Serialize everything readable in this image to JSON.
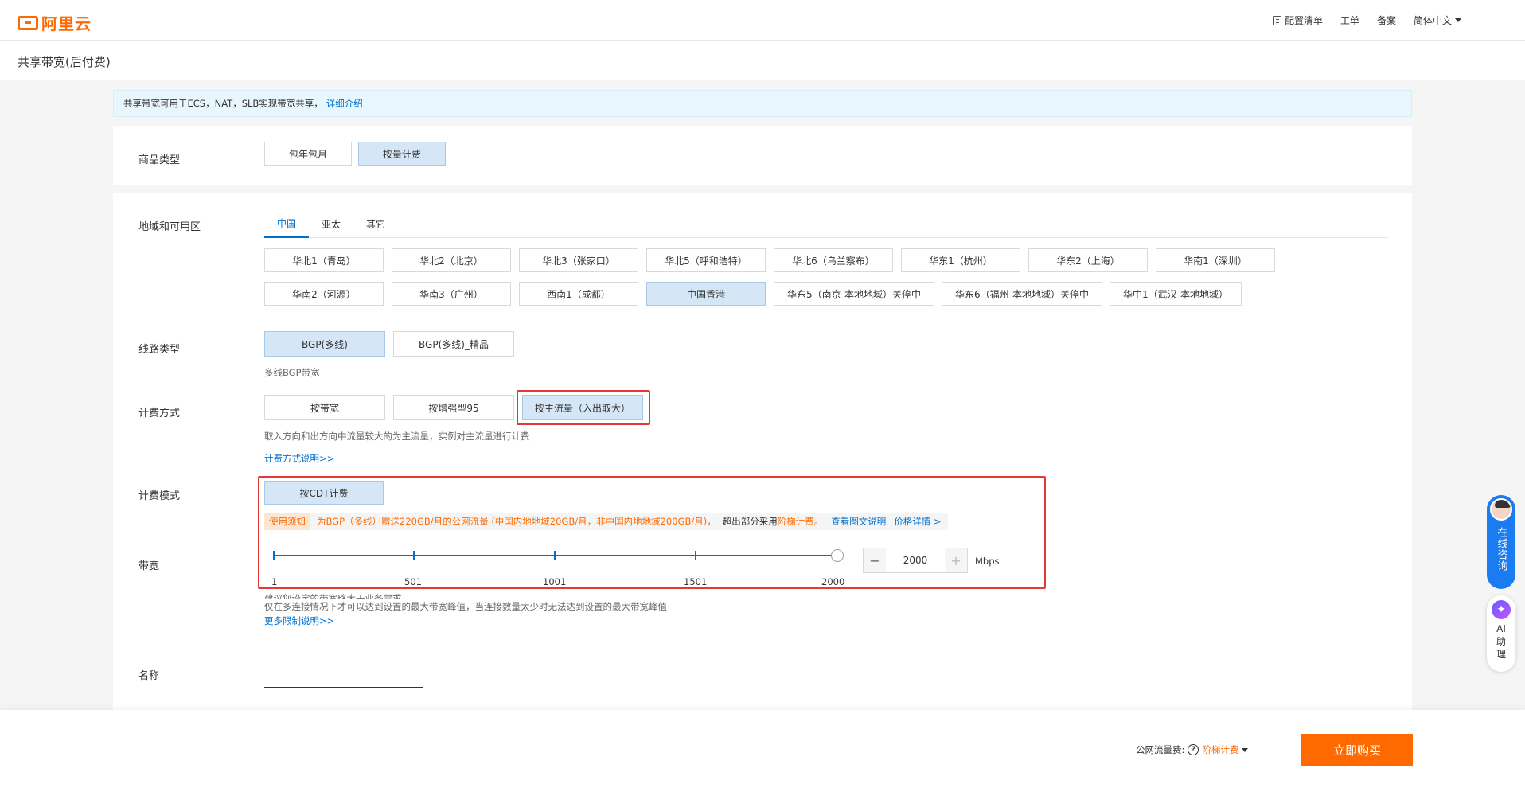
{
  "header": {
    "brand": "阿里云",
    "nav": [
      "配置清单",
      "工单",
      "备案",
      "简体中文"
    ]
  },
  "page_title": "共享带宽(后付费)",
  "notice": {
    "text": "共享带宽可用于ECS，NAT，SLB实现带宽共享，",
    "link": "详细介绍"
  },
  "product_type": {
    "label": "商品类型",
    "options": [
      "包年包月",
      "按量计费"
    ],
    "selected": "按量计费"
  },
  "region": {
    "label": "地域和可用区",
    "tabs": [
      "中国",
      "亚太",
      "其它"
    ],
    "active_tab": "中国",
    "row1": [
      "华北1（青岛）",
      "华北2（北京）",
      "华北3（张家口）",
      "华北5（呼和浩特）",
      "华北6（乌兰察布）",
      "华东1（杭州）",
      "华东2（上海）",
      "华南1（深圳）"
    ],
    "row2": [
      "华南2（河源）",
      "华南3（广州）",
      "西南1（成都）",
      "中国香港",
      "华东5（南京-本地地域）关停中",
      "华东6（福州-本地地域）关停中",
      "华中1（武汉-本地地域）"
    ],
    "selected": "中国香港"
  },
  "line_type": {
    "label": "线路类型",
    "options": [
      "BGP(多线)",
      "BGP(多线)_精品"
    ],
    "selected": "BGP(多线)",
    "hint": "多线BGP带宽"
  },
  "billing_method": {
    "label": "计费方式",
    "options": [
      "按带宽",
      "按增强型95",
      "按主流量（入出取大）"
    ],
    "selected": "按主流量（入出取大）",
    "hint": "取入方向和出方向中流量较大的为主流量，实例对主流量进行计费",
    "link": "计费方式说明>>"
  },
  "billing_mode": {
    "label": "计费模式",
    "option": "按CDT计费",
    "notice_tag": "使用须知",
    "notice_text": "为BGP（多线）赠送220GB/月的公网流量 (中国内地地域20GB/月，非中国内地地域200GB/月)，",
    "notice_text2": "超出部分采用",
    "notice_tier": "阶梯计费。",
    "link1": "查看图文说明",
    "link2": "价格详情 >"
  },
  "bandwidth": {
    "label": "带宽",
    "value": "2000",
    "unit": "Mbps",
    "min": 1,
    "max": 2000,
    "ticks": [
      "1",
      "501",
      "1001",
      "1501",
      "2000"
    ],
    "minus": "−",
    "plus": "+",
    "hint1": "建议您设定的带宽略大于业务需求",
    "hint2": "仅在多连接情况下才可以达到设置的最大带宽峰值，当连接数量太少时无法达到设置的最大带宽峰值",
    "link": "更多限制说明>>"
  },
  "name": {
    "label": "名称",
    "value": ""
  },
  "float": {
    "chat": "在线咨询",
    "ai": "AI助理"
  },
  "footer": {
    "fee_label": "公网流量费:",
    "fee_value": "阶梯计费",
    "buy": "立即购买"
  },
  "colors": {
    "brand": "#ff6a00",
    "link": "#0070cc",
    "selected_bg": "#d5e6f6",
    "highlight": "#e53935"
  }
}
